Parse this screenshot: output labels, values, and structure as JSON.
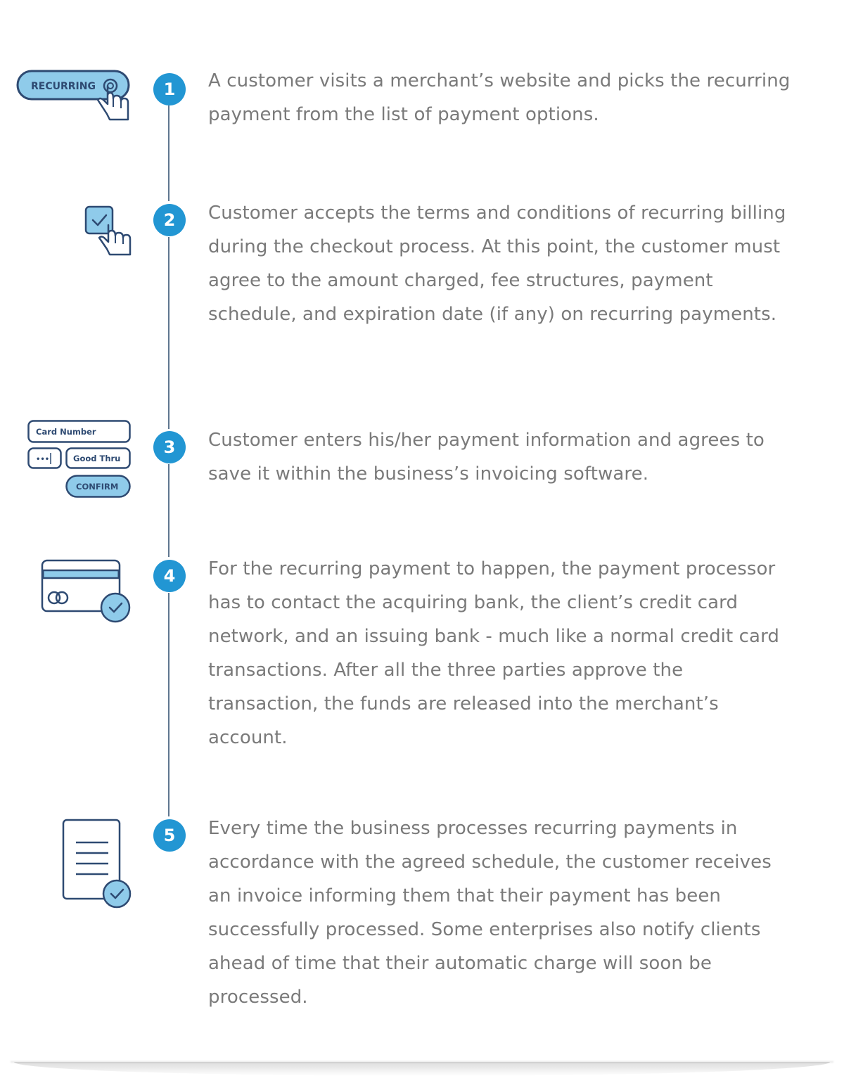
{
  "accent_color": "#2296d3",
  "steps": [
    {
      "number": "1",
      "icon": "recurring-button-click-icon",
      "icon_label": "RECURRING",
      "text": "A customer visits a merchant’s website and picks the recurring payment from the list of payment options."
    },
    {
      "number": "2",
      "icon": "checkbox-click-icon",
      "text": "Customer accepts the terms and conditions of recurring billing during the checkout process. At this point, the customer must agree to the amount charged, fee structures, payment schedule, and expiration date (if any) on recurring payments."
    },
    {
      "number": "3",
      "icon": "payment-form-icon",
      "form": {
        "card_number_label": "Card Number",
        "cvv_value": "•••",
        "good_thru_label": "Good Thru",
        "confirm_label": "CONFIRM"
      },
      "text": "Customer enters his/her payment information and agrees to save it within the business’s invoicing software."
    },
    {
      "number": "4",
      "icon": "credit-card-check-icon",
      "text": "For the recurring payment to happen, the payment processor has to contact the acquiring bank, the client’s credit card network, and an issuing bank - much like a normal credit card transactions. After all the three parties approve the transaction, the funds are released into the merchant’s account."
    },
    {
      "number": "5",
      "icon": "invoice-check-icon",
      "text": "Every time the business processes recurring payments in accordance with the agreed schedule, the customer receives an invoice informing them that their payment has been successfully processed. Some enterprises also notify clients ahead of time that their automatic charge will soon be processed."
    }
  ]
}
